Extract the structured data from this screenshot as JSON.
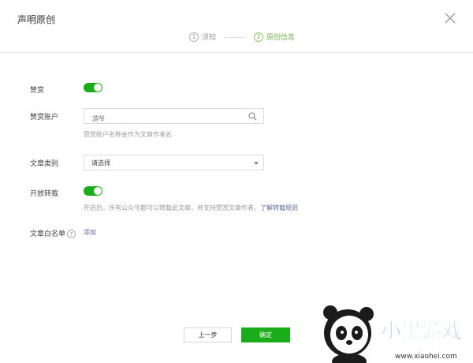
{
  "dialog": {
    "title": "声明原创",
    "close_icon": "close-icon"
  },
  "steps": [
    {
      "num": "1",
      "label": "须知",
      "active": false
    },
    {
      "num": "2",
      "label": "原创信息",
      "active": true
    }
  ],
  "form": {
    "reward": {
      "label": "赞赏",
      "enabled": true
    },
    "reward_account": {
      "label": "赞赏账户",
      "value": "游爷",
      "hint": "赞赏账户名称会作为文章作者名"
    },
    "category": {
      "label": "文章类别",
      "selected": "请选择"
    },
    "repost": {
      "label": "开放转载",
      "enabled": true,
      "hint": "开启后，所有公众号都可以转载此文章，并支持赞赏文章作者。",
      "hint_link": "了解转载规则"
    },
    "whitelist": {
      "label": "文章白名单",
      "help_icon": "question-icon",
      "help_glyph": "?",
      "add_label": "添加"
    }
  },
  "footer": {
    "prev_label": "上一步",
    "confirm_label": "确定"
  },
  "watermark": {
    "brand": "小黑游戏",
    "url": "www.xiaohei.com"
  },
  "colors": {
    "accent": "#1aad19",
    "link": "#576b95"
  }
}
